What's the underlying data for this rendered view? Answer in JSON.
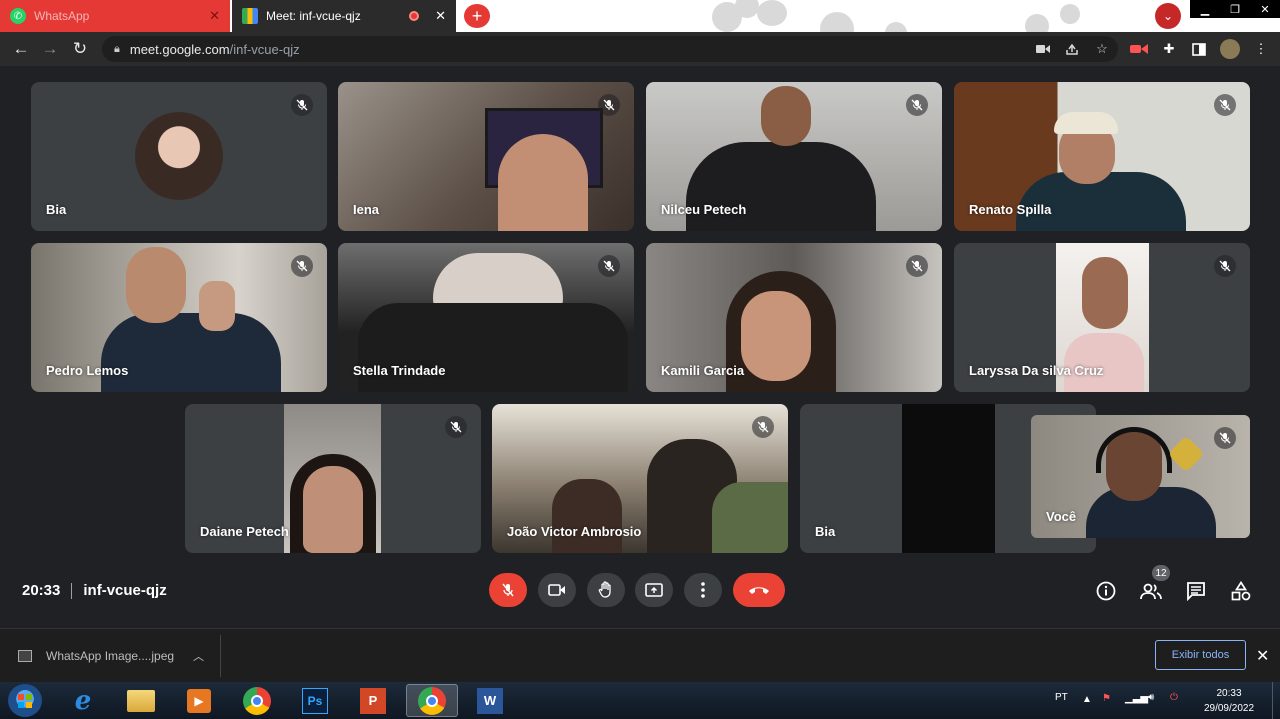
{
  "browser": {
    "tabs": [
      {
        "label": "WhatsApp",
        "icon": "whatsapp-icon"
      },
      {
        "label": "Meet: inf-vcue-qjz",
        "icon": "google-meet-icon"
      }
    ],
    "url_host": "meet.google.com",
    "url_path": "/inf-vcue-qjz"
  },
  "participants": [
    {
      "name": "Bia"
    },
    {
      "name": "Iena"
    },
    {
      "name": "Nilceu Petech"
    },
    {
      "name": "Renato Spilla"
    },
    {
      "name": "Pedro Lemos"
    },
    {
      "name": "Stella Trindade"
    },
    {
      "name": "Kamili Garcia"
    },
    {
      "name": "Laryssa Da silva Cruz"
    },
    {
      "name": "Daiane Petech"
    },
    {
      "name": "João Victor Ambrosio"
    },
    {
      "name": "Bia"
    },
    {
      "name": "Você"
    }
  ],
  "meeting": {
    "time": "20:33",
    "code": "inf-vcue-qjz",
    "people_count": "12"
  },
  "download": {
    "file": "WhatsApp Image....jpeg",
    "show_all": "Exibir todos"
  },
  "taskbar": {
    "lang": "PT",
    "time": "20:33",
    "date": "29/09/2022",
    "apps": [
      "internet-explorer-icon",
      "file-explorer-icon",
      "media-player-icon",
      "chrome-icon",
      "photoshop-icon",
      "powerpoint-icon",
      "chrome-active-icon",
      "word-icon"
    ]
  },
  "colors": {
    "meet_background": "#202124",
    "tile_background": "#3c4043",
    "red_control": "#ea4335",
    "link_blue": "#8ab4f8"
  }
}
